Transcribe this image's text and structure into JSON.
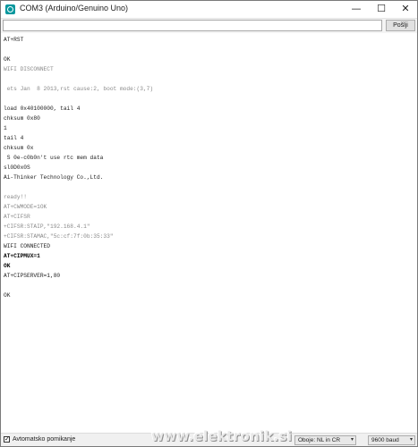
{
  "window": {
    "title": "COM3 (Arduino/Genuino Uno)",
    "controls": {
      "minimize": "—",
      "maximize": "☐",
      "close": "✕"
    }
  },
  "send_bar": {
    "input_value": "",
    "button_label": "Pošlji"
  },
  "output": {
    "lines": [
      {
        "text": "AT+RST",
        "style": "normal"
      },
      {
        "text": "",
        "style": "normal"
      },
      {
        "text": "OK",
        "style": "normal"
      },
      {
        "text": "WIFI DISCONNECT",
        "style": "faint"
      },
      {
        "text": "",
        "style": "normal"
      },
      {
        "text": " ets Jan  8 2013,rst cause:2, boot mode:(3,7)",
        "style": "faint"
      },
      {
        "text": "",
        "style": "normal"
      },
      {
        "text": "load 0x40100000, tail 4",
        "style": "normal"
      },
      {
        "text": "chksum 0x80",
        "style": "normal"
      },
      {
        "text": "1",
        "style": "normal"
      },
      {
        "text": "tail 4",
        "style": "normal"
      },
      {
        "text": "chksum 0x",
        "style": "normal"
      },
      {
        "text": " S 0e-c0b0n't use rtc mem data",
        "style": "normal"
      },
      {
        "text": "sl0D0x0S",
        "style": "normal"
      },
      {
        "text": "Ai-Thinker Technology Co.,Ltd.",
        "style": "normal"
      },
      {
        "text": "",
        "style": "normal"
      },
      {
        "text": "ready!!",
        "style": "faint"
      },
      {
        "text": "AT+CWMODE=1OK",
        "style": "faint"
      },
      {
        "text": "AT+CIFSR",
        "style": "faint"
      },
      {
        "text": "+CIFSR:STAIP,\"192.168.4.1\"",
        "style": "faint"
      },
      {
        "text": "+CIFSR:STAMAC,\"5c:cf:7f:0b:35:33\"",
        "style": "faint"
      },
      {
        "text": "WIFI CONNECTED",
        "style": "normal"
      },
      {
        "text": "AT+CIPMUX=1",
        "style": "bold"
      },
      {
        "text": "OK",
        "style": "bold"
      },
      {
        "text": "AT+CIPSERVER=1,80",
        "style": "normal"
      },
      {
        "text": "",
        "style": "normal"
      },
      {
        "text": "OK",
        "style": "normal"
      }
    ]
  },
  "status_bar": {
    "autoscroll_label": "Avtomatsko pomikanje",
    "autoscroll_checked": true,
    "checkmark": "✓",
    "line_ending": "Oboje: NL in CR",
    "baud_rate": "9600 baud",
    "dropdown_arrow": "▾"
  },
  "watermark": "www.elektronik.si"
}
